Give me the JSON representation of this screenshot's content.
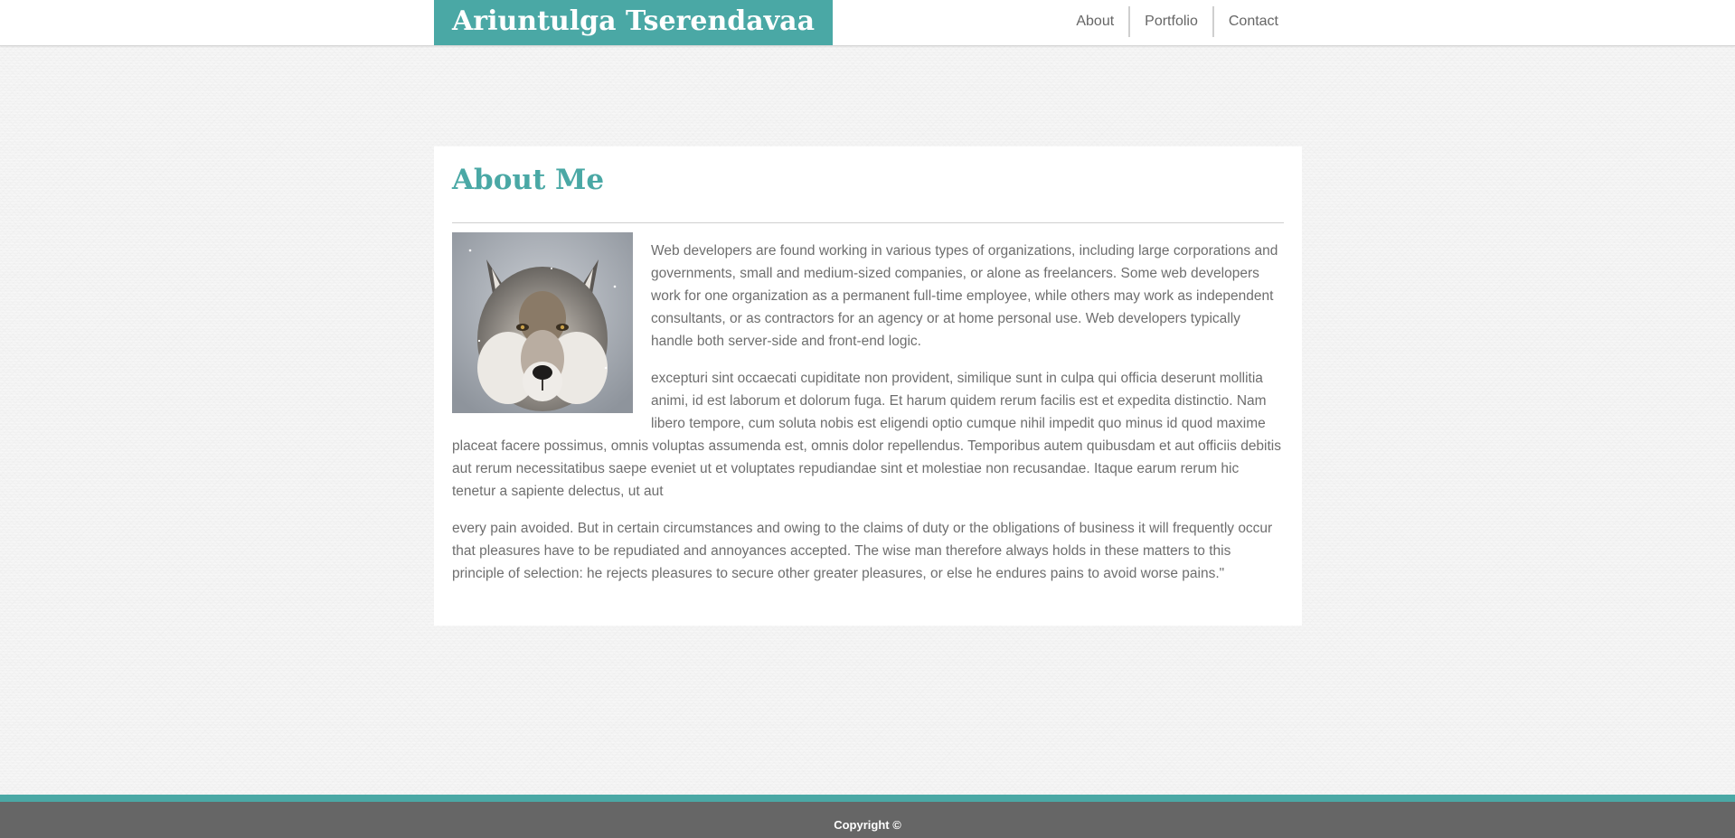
{
  "header": {
    "site_title": "Ariuntulga Tserendavaa",
    "nav": [
      {
        "label": "About"
      },
      {
        "label": "Portfolio"
      },
      {
        "label": "Contact"
      }
    ]
  },
  "main": {
    "heading": "About Me",
    "image": {
      "icon": "wolf-portrait"
    },
    "paragraphs": [
      "Web developers are found working in various types of organizations, including large corporations and governments, small and medium-sized companies, or alone as freelancers. Some web developers work for one organization as a permanent full-time employee, while others may work as independent consultants, or as contractors for an agency or at home personal use. Web developers typically handle both server-side and front-end logic.",
      "excepturi sint occaecati cupiditate non provident, similique sunt in culpa qui officia deserunt mollitia animi, id est laborum et dolorum fuga. Et harum quidem rerum facilis est et expedita distinctio. Nam libero tempore, cum soluta nobis est eligendi optio cumque nihil impedit quo minus id quod maxime placeat facere possimus, omnis voluptas assumenda est, omnis dolor repellendus. Temporibus autem quibusdam et aut officiis debitis aut rerum necessitatibus saepe eveniet ut et voluptates repudiandae sint et molestiae non recusandae. Itaque earum rerum hic tenetur a sapiente delectus, ut aut",
      "every pain avoided. But in certain circumstances and owing to the claims of duty or the obligations of business it will frequently occur that pleasures have to be repudiated and annoyances accepted. The wise man therefore always holds in these matters to this principle of selection: he rejects pleasures to secure other greater pleasures, or else he endures pains to avoid worse pains.\""
    ]
  },
  "footer": {
    "copyright": "Copyright ©"
  },
  "colors": {
    "accent": "#4aa8a5",
    "footer": "#666666",
    "text": "#6e6e6e"
  }
}
